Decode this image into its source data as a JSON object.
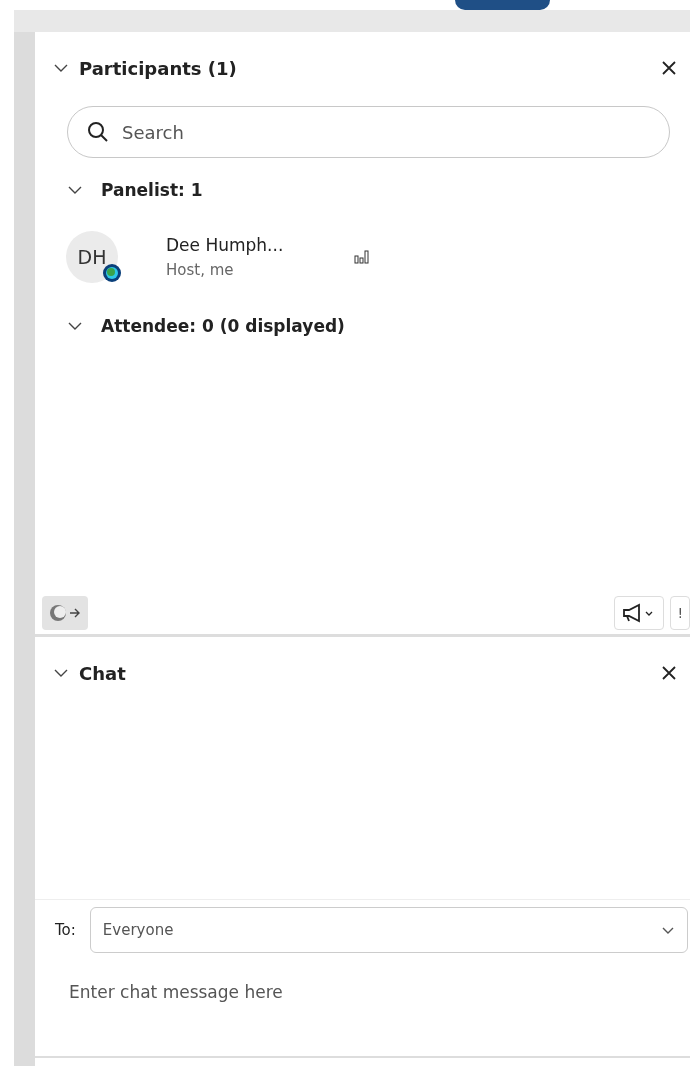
{
  "participants": {
    "title": "Participants (1)",
    "expanded": true,
    "search": {
      "placeholder": "Search"
    },
    "groups": [
      {
        "label": "Panelist: 1",
        "expanded": true,
        "members": [
          {
            "initials": "DH",
            "name": "Dee Humph...",
            "role": "Host, me"
          }
        ]
      },
      {
        "label": "Attendee: 0 (0 displayed)",
        "expanded": true
      }
    ],
    "toolbar": {
      "more_label": "!"
    }
  },
  "chat": {
    "title": "Chat",
    "expanded": true,
    "to_label": "To:",
    "recipient": "Everyone",
    "message": {
      "placeholder": "Enter chat message here"
    }
  }
}
